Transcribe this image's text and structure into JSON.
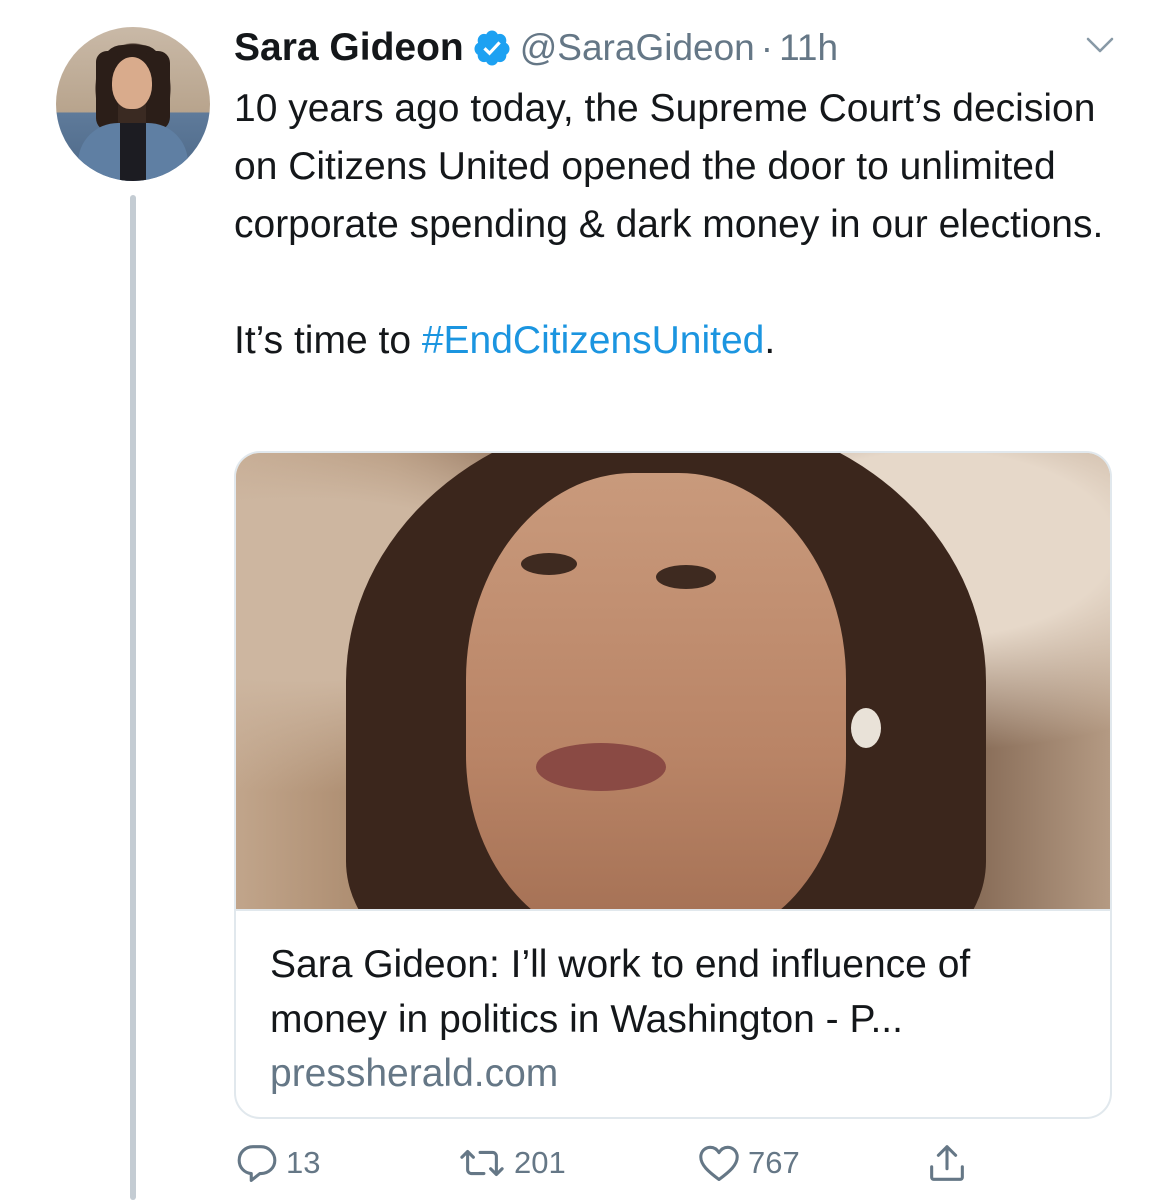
{
  "tweet": {
    "author_name": "Sara Gideon",
    "handle": "@SaraGideon",
    "separator": "·",
    "time": "11h",
    "text_line1": "10 years ago today, the Supreme Court’s decision on Citizens United opened the door to unlimited corporate spending & dark money in our elections.",
    "text_line2_prefix": "It’s time to ",
    "hashtag": "#EndCitizensUnited",
    "text_line2_suffix": "."
  },
  "card": {
    "title": "Sara Gideon: I’ll work to end influence of money in politics in Washington - P...",
    "domain": "pressherald.com"
  },
  "actions": {
    "replies": "13",
    "retweets": "201",
    "likes": "767"
  },
  "icons": {
    "verified": "verified-badge-icon",
    "menu": "chevron-down-icon",
    "reply": "reply-icon",
    "retweet": "retweet-icon",
    "like": "heart-icon",
    "share": "share-icon"
  },
  "colors": {
    "link": "#1b95e0",
    "secondary_text": "#657786",
    "verified": "#1da1f2",
    "thread_line": "#c4ccd3"
  }
}
